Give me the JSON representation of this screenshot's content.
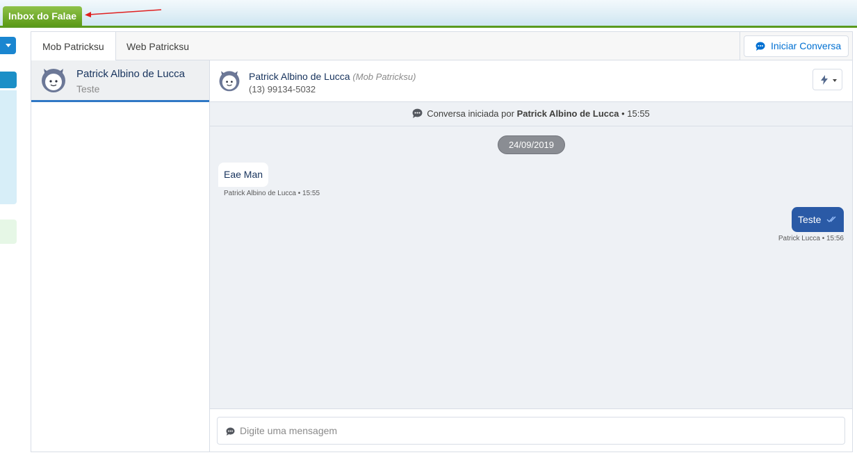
{
  "app_tab": {
    "label": "Inbox do Falae"
  },
  "channels": {
    "tabs": [
      {
        "label": "Mob Patricksu"
      },
      {
        "label": "Web Patricksu"
      }
    ],
    "start_button": "Iniciar Conversa"
  },
  "contacts": [
    {
      "name": "Patrick Albino de Lucca",
      "last_message": "Teste"
    }
  ],
  "chat": {
    "contact_name": "Patrick Albino de Lucca",
    "channel": "(Mob Patricksu)",
    "phone": "(13) 99134-5032",
    "started_prefix": "Conversa iniciada por",
    "started_by": "Patrick Albino de Lucca",
    "started_time": "• 15:55",
    "date": "24/09/2019",
    "messages": [
      {
        "direction": "in",
        "text": "Eae Man",
        "meta": "Patrick Albino de Lucca • 15:55"
      },
      {
        "direction": "out",
        "text": "Teste",
        "meta": "Patrick Lucca • 15:56"
      }
    ]
  },
  "composer": {
    "placeholder": "Digite uma mensagem"
  },
  "colors": {
    "brand_green": "#5d9b18",
    "accent_blue": "#2a5aa6",
    "link_blue": "#0070d2"
  },
  "icons": [
    "chat-bubble-icon",
    "lightning-icon",
    "double-check-icon",
    "avatar-icon",
    "arrow-annotation"
  ]
}
